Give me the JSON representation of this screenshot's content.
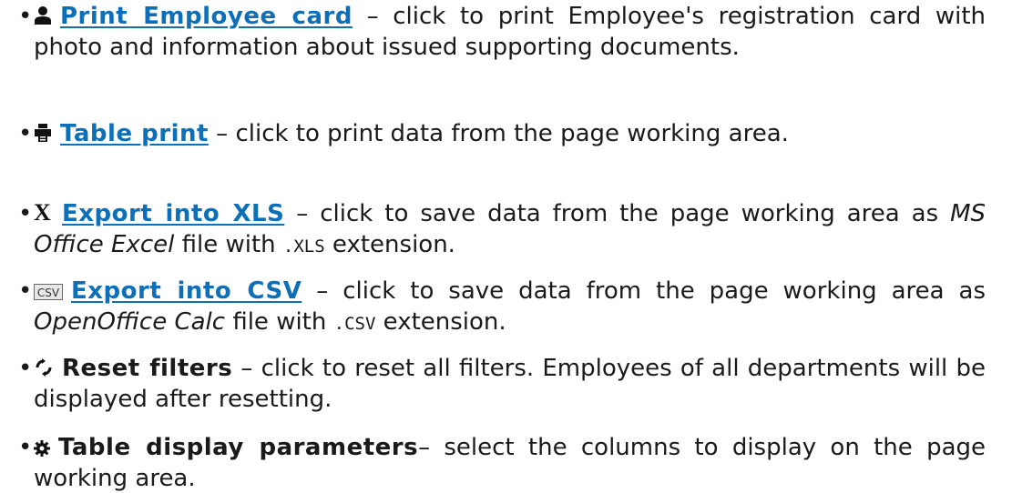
{
  "items": [
    {
      "icon": "person-icon",
      "label": "Print Employee card",
      "dash": " – ",
      "text": "click to print Employee's registration card with photo and information about issued supporting documents."
    },
    {
      "icon": "printer-icon",
      "label": "Table print",
      "dash": " – ",
      "text": "click to print data from the page working area."
    },
    {
      "icon": "excel-x-icon",
      "label": "Export into XLS",
      "dash": " – ",
      "text_before": "click to save data from the page working area as ",
      "italic": "MS Office Excel",
      "text_mid": " file with ",
      "code": ".XLS",
      "text_after": " extension."
    },
    {
      "icon": "csv-icon",
      "icon_text": "CSV",
      "label": "Export into CSV",
      "dash": " – ",
      "text_before": "click to save data from the page working area as ",
      "italic": "OpenOffice Calc",
      "text_mid": " file with ",
      "code": ".CSV",
      "text_after": " extension."
    },
    {
      "icon": "refresh-icon",
      "label": "Reset filters",
      "dash": " – ",
      "text": "click to reset all filters. Employees of all departments will be displayed after resetting."
    },
    {
      "icon": "gear-icon",
      "label": "Table display parameters",
      "dash": "– ",
      "text": "select the columns to display on the page working area."
    }
  ],
  "colors": {
    "link": "#0d6fb8",
    "text": "#1a1a1a"
  }
}
